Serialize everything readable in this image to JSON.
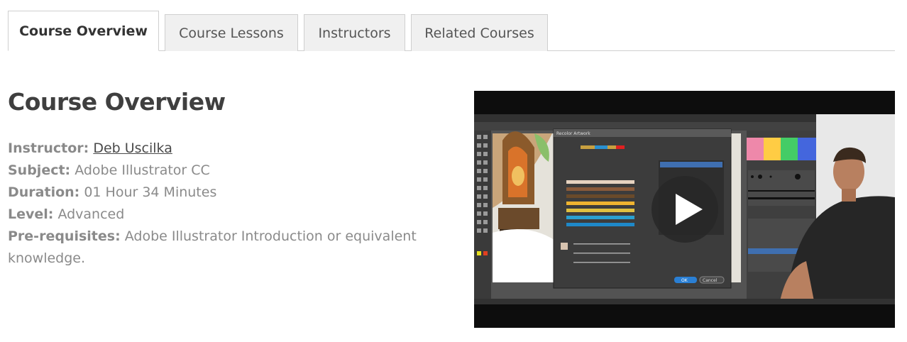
{
  "tabs": [
    {
      "label": "Course Overview",
      "active": true
    },
    {
      "label": "Course Lessons",
      "active": false
    },
    {
      "label": "Instructors",
      "active": false
    },
    {
      "label": "Related Courses",
      "active": false
    }
  ],
  "overview": {
    "title": "Course Overview",
    "instructor_label": "Instructor:",
    "instructor_name": "Deb Uscilka",
    "subject_label": "Subject:",
    "subject_value": "Adobe Illustrator CC",
    "duration_label": "Duration:",
    "duration_value": "01 Hour 34 Minutes",
    "level_label": "Level:",
    "level_value": "Advanced",
    "prereq_label": "Pre-requisites:",
    "prereq_value_line1": "Adobe Illustrator Introduction or equivalent",
    "prereq_value_line2": "knowledge."
  },
  "video": {
    "play_icon": "play-icon",
    "dialog_title": "Recolor Artwork",
    "ok_label": "OK",
    "cancel_label": "Cancel"
  }
}
